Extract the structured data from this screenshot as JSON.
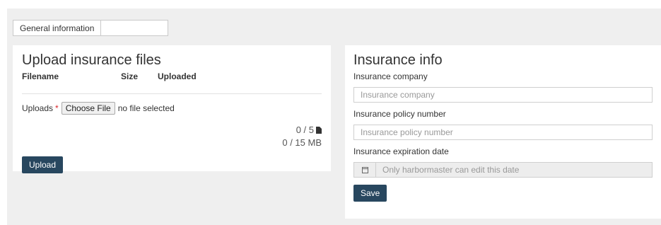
{
  "tabs": [
    {
      "label": "General information"
    },
    {
      "label": "Insurance info"
    }
  ],
  "upload": {
    "title": "Upload insurance files",
    "columns": [
      "Filename",
      "Size",
      "Uploaded"
    ],
    "uploads_label": "Uploads",
    "required_mark": "*",
    "choose_label": "Choose File",
    "no_file_text": "no file selected",
    "file_count": "0 / 5",
    "size_limit": "0 / 15 MB",
    "upload_button": "Upload"
  },
  "insurance": {
    "title": "Insurance info",
    "company_label": "Insurance company",
    "company_placeholder": "Insurance company",
    "policy_label": "Insurance policy number",
    "policy_placeholder": "Insurance policy number",
    "expiration_label": "Insurance expiration date",
    "expiration_placeholder": "Only harbormaster can edit this date",
    "save_button": "Save"
  },
  "colors": {
    "primary": "#28475f",
    "required": "#d9262a",
    "background": "#efefef"
  },
  "icons": [
    "file-icon",
    "calendar-icon"
  ]
}
